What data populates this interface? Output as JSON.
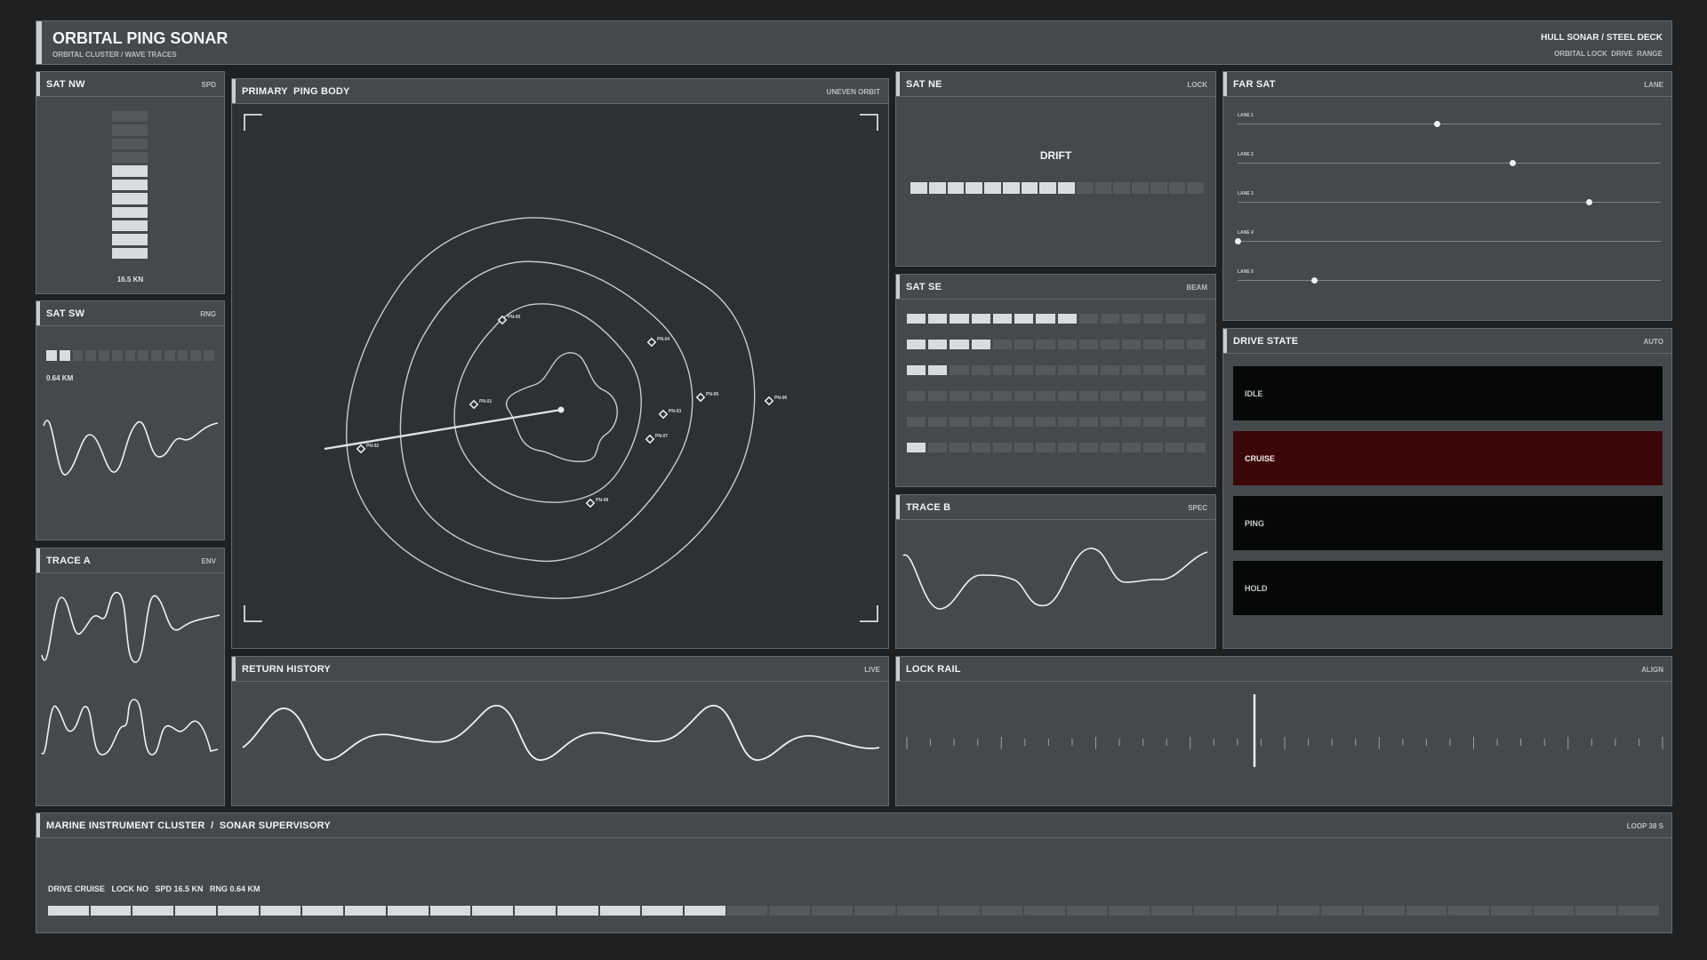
{
  "header": {
    "title": "ORBITAL PING SONAR",
    "subtitle": "ORBITAL CLUSTER / WAVE TRACES",
    "right_title": "HULL SONAR / STEEL DECK",
    "right_sub": "ORBITAL LOCK  DRIVE  RANGE"
  },
  "sat_nw": {
    "title": "SAT NW",
    "tag": "SPD",
    "value": "16.5 KN",
    "level_segments": 7,
    "total_segments": 11
  },
  "sat_sw": {
    "title": "SAT SW",
    "tag": "RNG",
    "value": "0.64 KM",
    "level_segments": 2,
    "total_segments": 13
  },
  "trace_a": {
    "title": "TRACE A",
    "tag": "ENV"
  },
  "primary": {
    "title": "PRIMARY  PING BODY",
    "tag": "UNEVEN ORBIT",
    "points": [
      "PN-01",
      "PN-02",
      "PN-03",
      "PN-04",
      "PN-05",
      "PN-06",
      "PN-07",
      "PN-08",
      "PN-09"
    ]
  },
  "sat_ne": {
    "title": "SAT NE",
    "tag": "LOCK",
    "state": "DRIFT",
    "level_segments": 9,
    "total_segments": 16
  },
  "sat_se": {
    "title": "SAT SE",
    "tag": "BEAM",
    "rows": [
      8,
      4,
      2,
      0,
      0,
      1
    ],
    "total_segments": 14
  },
  "trace_b": {
    "title": "TRACE B",
    "tag": "SPEC"
  },
  "far_sat": {
    "title": "FAR SAT",
    "tag": "LANE",
    "lanes": [
      {
        "label": "LANE 1",
        "pos": 0.47
      },
      {
        "label": "LANE 2",
        "pos": 0.65
      },
      {
        "label": "LANE 3",
        "pos": 0.83
      },
      {
        "label": "LANE 4",
        "pos": 0.0
      },
      {
        "label": "LANE 5",
        "pos": 0.18
      }
    ]
  },
  "drive_state": {
    "title": "DRIVE STATE",
    "tag": "AUTO",
    "states": [
      {
        "label": "IDLE",
        "active": false
      },
      {
        "label": "CRUISE",
        "active": true
      },
      {
        "label": "PING",
        "active": false
      },
      {
        "label": "HOLD",
        "active": false
      }
    ],
    "colors": {
      "idle_bg": "#060808",
      "active_bg": "#3b0708"
    }
  },
  "return_history": {
    "title": "RETURN HISTORY",
    "tag": "LIVE"
  },
  "lock_rail": {
    "title": "LOCK RAIL",
    "tag": "ALIGN",
    "marker_pos": 0.46
  },
  "footer": {
    "title": "MARINE INSTRUMENT CLUSTER  /  SONAR SUPERVISORY",
    "tag": "LOOP 38 S",
    "status": "DRIVE CRUISE   LOCK NO   SPD 16.5 KN   RNG 0.64 KM",
    "level_segments": 16,
    "total_segments": 38
  }
}
